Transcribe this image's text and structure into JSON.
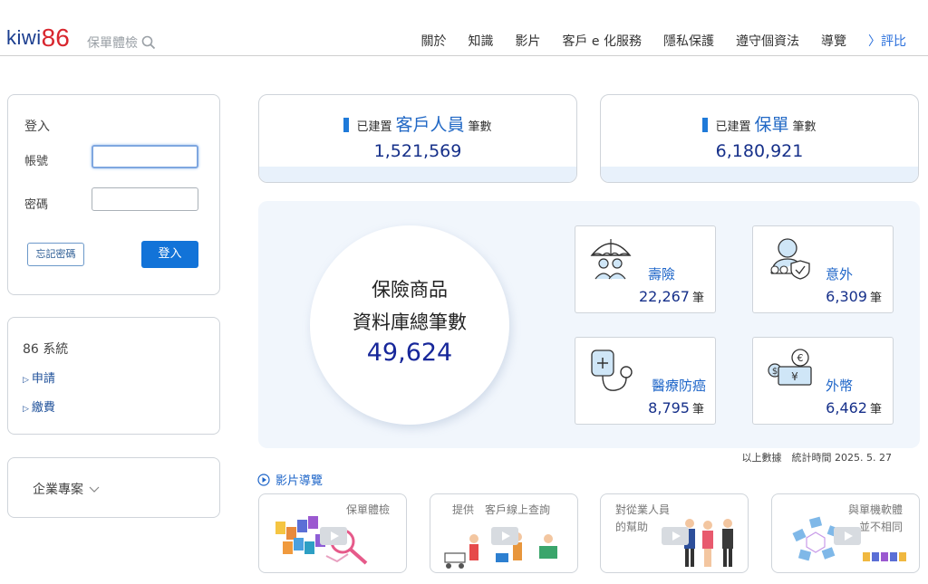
{
  "header": {
    "logo_text": "kiwi",
    "logo_num": "86",
    "search_label": "保單體檢",
    "nav": [
      "關於",
      "知識",
      "影片",
      "客戶 e 化服務",
      "隱私保護",
      "遵守個資法",
      "導覽",
      "〉評比"
    ]
  },
  "login": {
    "title": "登入",
    "account_label": "帳號",
    "account_value": "",
    "password_label": "密碼",
    "password_value": "",
    "forgot_label": "忘記密碼",
    "submit_label": "登入"
  },
  "system": {
    "title": "86 系統",
    "links": [
      "申請",
      "繳費"
    ]
  },
  "enterprise": {
    "label": "企業專案"
  },
  "stats": [
    {
      "prefix": "已建置",
      "highlight": "客戶人員",
      "suffix": "筆數",
      "value": "1,521,569"
    },
    {
      "prefix": "已建置",
      "highlight": "保單",
      "suffix": "筆數",
      "value": "6,180,921"
    }
  ],
  "database": {
    "line1": "保險商品",
    "line2": "資料庫總筆數",
    "total": "49,624"
  },
  "categories": [
    {
      "name": "壽險",
      "count": "22,267",
      "unit": "筆",
      "icon": "umbrella-family-icon"
    },
    {
      "name": "意外",
      "count": "6,309",
      "unit": "筆",
      "icon": "person-shield-icon"
    },
    {
      "name": "醫療防癌",
      "count": "8,795",
      "unit": "筆",
      "icon": "stethoscope-icon"
    },
    {
      "name": "外幣",
      "count": "6,462",
      "unit": "筆",
      "icon": "currency-icon"
    }
  ],
  "stat_time": "以上數據　統計時間  2025. 5. 27",
  "video": {
    "title": "影片導覽",
    "cards": [
      {
        "line1": "保單體檢",
        "line2": ""
      },
      {
        "line1": "提供　客戶線上查詢",
        "line2": ""
      },
      {
        "line1": "對從業人員",
        "line2": "的幫助"
      },
      {
        "line1": "與單機軟體",
        "line2": "並不相同"
      }
    ]
  },
  "colors": {
    "brand_blue": "#1273d8",
    "logo_red": "#d8262e",
    "panel_bg": "#f1f6fc",
    "number_navy": "#16308a"
  }
}
